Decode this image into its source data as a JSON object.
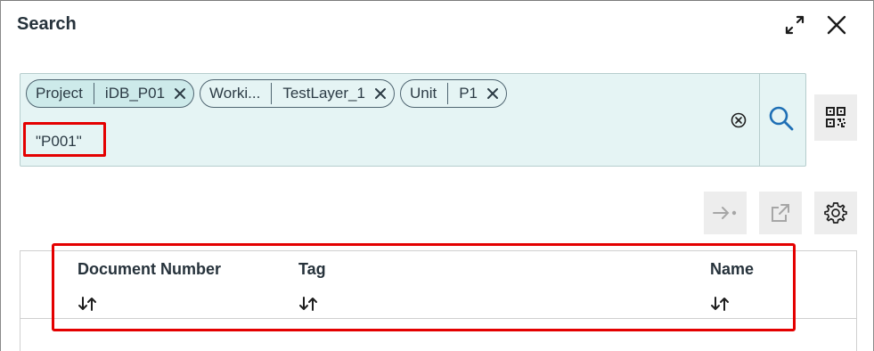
{
  "header": {
    "title": "Search"
  },
  "filters": [
    {
      "key": "Project",
      "value": "iDB_P01"
    },
    {
      "key": "Worki...",
      "value": "TestLayer_1"
    },
    {
      "key": "Unit",
      "value": "P1"
    }
  ],
  "search": {
    "query": "\"P001\""
  },
  "table": {
    "columns": [
      {
        "label": "Document Number"
      },
      {
        "label": "Tag"
      },
      {
        "label": "Name"
      }
    ]
  },
  "colors": {
    "search_bg": "#e5f4f4",
    "chip_active_bg": "#cdeaea",
    "accent_blue": "#1e6fb5",
    "highlight_red": "#e40000"
  }
}
